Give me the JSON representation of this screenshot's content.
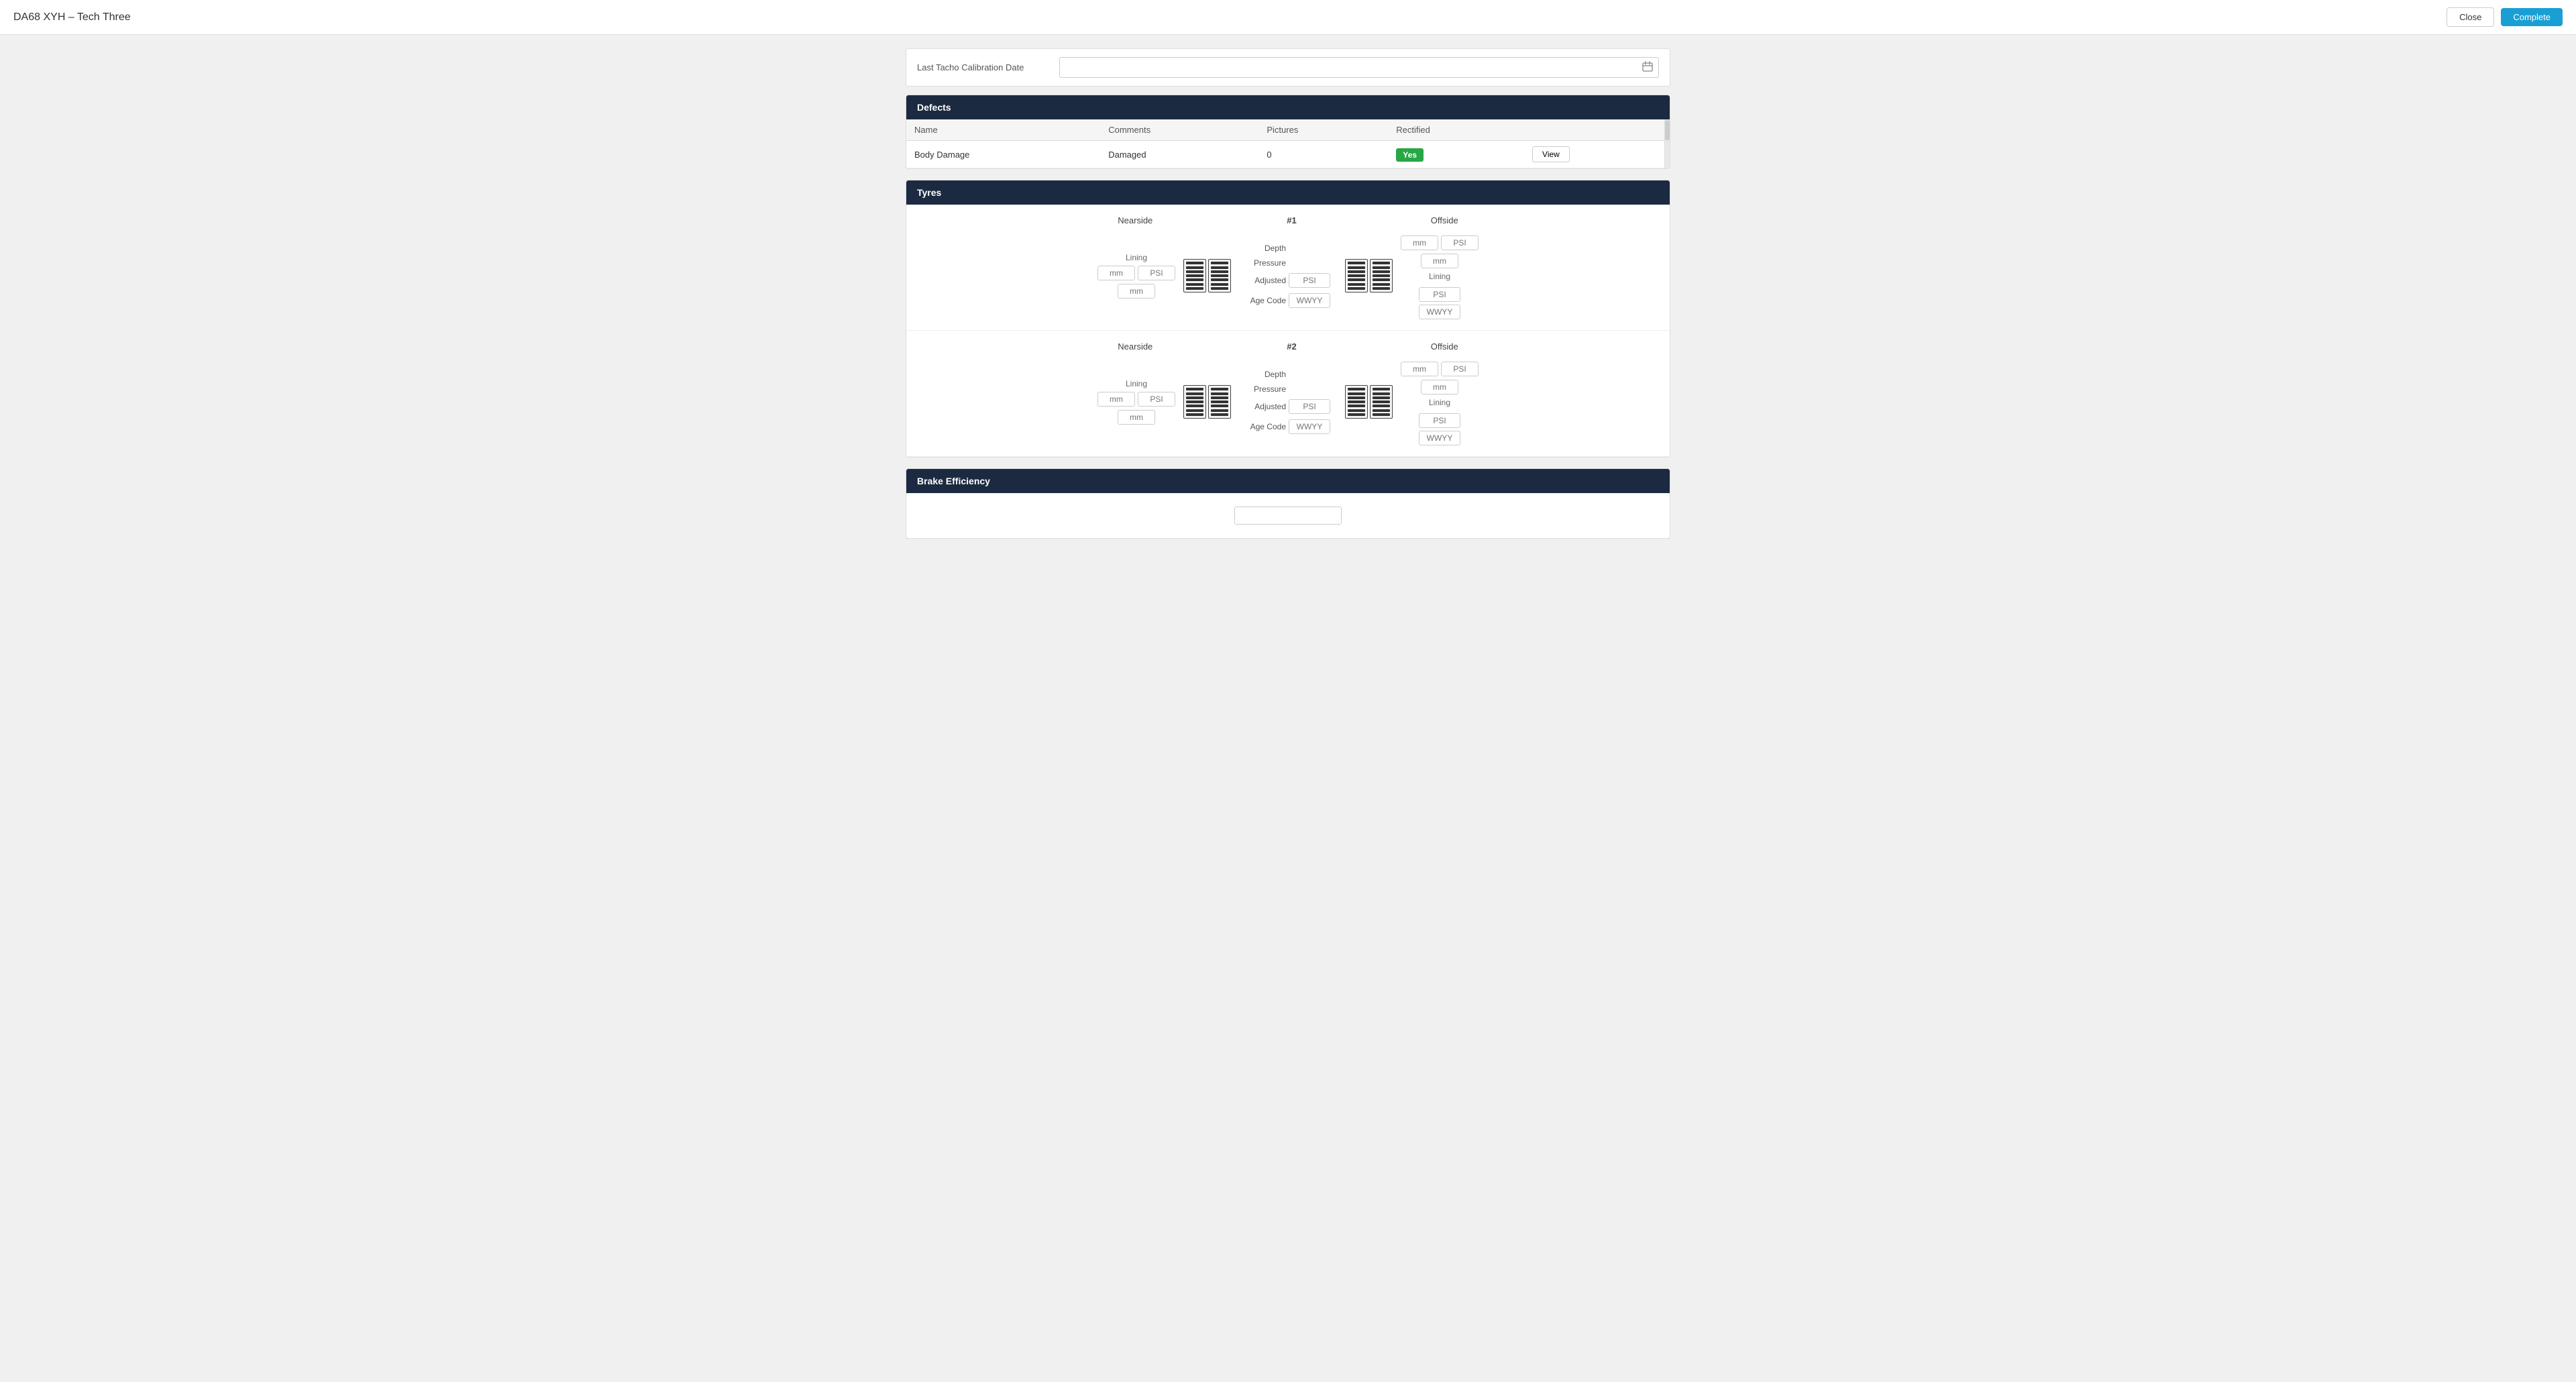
{
  "topbar": {
    "title": "DA68 XYH  –  Tech Three",
    "close_label": "Close",
    "complete_label": "Complete"
  },
  "calibration": {
    "label": "Last Tacho Calibration Date",
    "placeholder": "",
    "cal_icon": "📅"
  },
  "defects": {
    "section_title": "Defects",
    "columns": [
      "Name",
      "Comments",
      "Pictures",
      "Rectified"
    ],
    "rows": [
      {
        "name": "Body Damage",
        "comments": "Damaged",
        "pictures": "0",
        "rectified": "Yes",
        "view_label": "View"
      }
    ]
  },
  "tyres": {
    "section_title": "Tyres",
    "tyre_rows": [
      {
        "number": "#1",
        "nearside_label": "Nearside",
        "offside_label": "Offside",
        "lining_label": "Lining",
        "depth_label": "Depth",
        "pressure_label": "Pressure",
        "adjusted_label": "Adjusted",
        "age_code_label": "Age Code",
        "nearside_mm_top": "mm",
        "nearside_psi": "PSI",
        "nearside_mm_bottom": "mm",
        "offside_mm_top": "mm",
        "offside_psi": "PSI",
        "offside_mm_bottom": "mm",
        "nearside_adjusted_psi": "PSI",
        "nearside_age_wwyy": "WWYY",
        "offside_adjusted_psi": "PSI",
        "offside_age_wwyy": "WWYY"
      },
      {
        "number": "#2",
        "nearside_label": "Nearside",
        "offside_label": "Offside",
        "lining_label": "Lining",
        "depth_label": "Depth",
        "pressure_label": "Pressure",
        "adjusted_label": "Adjusted",
        "age_code_label": "Age Code",
        "nearside_mm_top": "mm",
        "nearside_psi": "PSI",
        "nearside_mm_bottom": "mm",
        "offside_mm_top": "mm",
        "offside_psi": "PSI",
        "offside_mm_bottom": "mm",
        "nearside_adjusted_psi": "PSI",
        "nearside_age_wwyy": "WWYY",
        "offside_adjusted_psi": "PSI",
        "offside_age_wwyy": "WWYY"
      }
    ]
  },
  "brake_efficiency": {
    "section_title": "Brake Efficiency"
  }
}
